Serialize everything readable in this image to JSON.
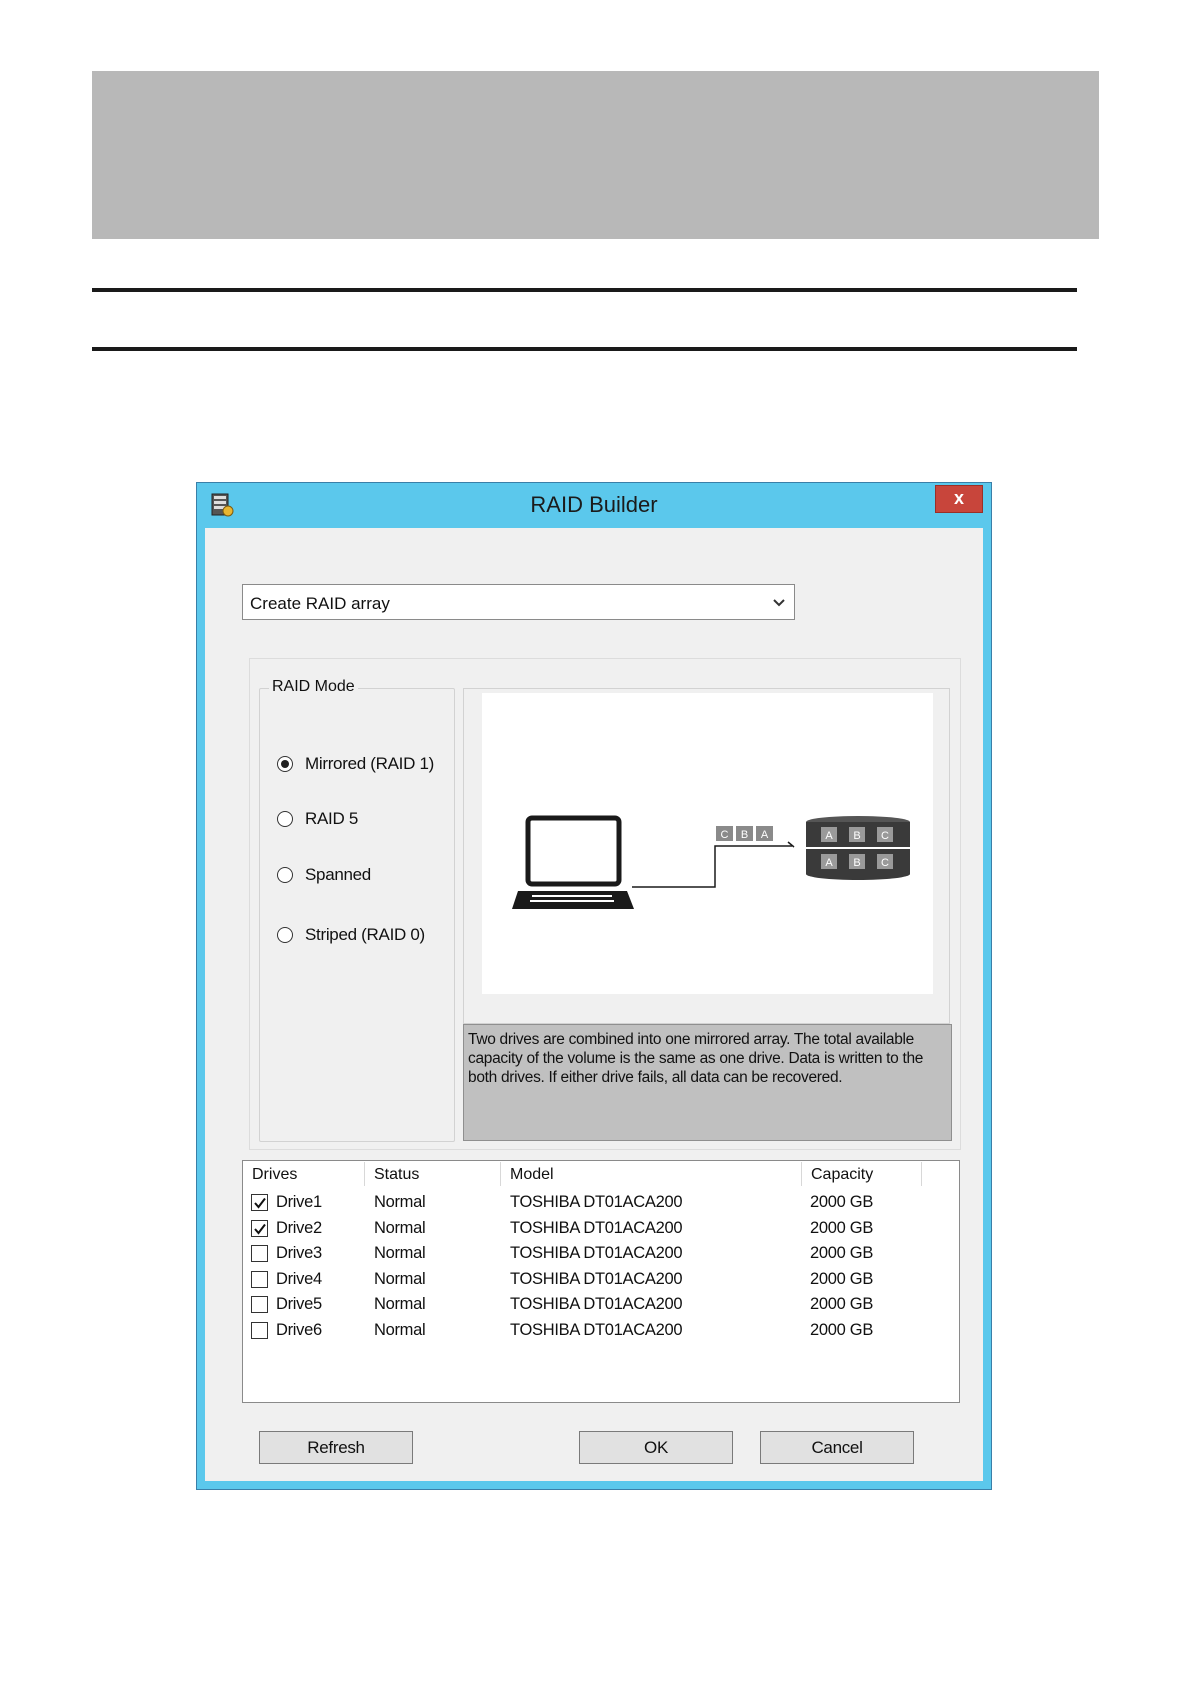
{
  "dialog": {
    "title": "RAID Builder",
    "app_icon": "raid-drive-icon",
    "close_label": "x"
  },
  "operation_select": {
    "value": "Create RAID array",
    "icon": "chevron-down-icon"
  },
  "raid_mode": {
    "legend": "RAID Mode",
    "options": [
      {
        "label": "Mirrored (RAID 1)",
        "checked": true
      },
      {
        "label": "RAID 5",
        "checked": false
      },
      {
        "label": "Spanned",
        "checked": false
      },
      {
        "label": "Striped (RAID 0)",
        "checked": false
      }
    ]
  },
  "diagram": {
    "computer_icon": "laptop-icon",
    "data_blocks": [
      "C",
      "B",
      "A"
    ],
    "disk_rows": [
      [
        "A",
        "B",
        "C"
      ],
      [
        "A",
        "B",
        "C"
      ]
    ]
  },
  "description": "Two drives are combined into one mirrored array. The total available capacity of the volume is the same as one drive. Data is written to the both drives. If either drive fails, all data can be recovered.",
  "drive_table": {
    "columns": {
      "drives": "Drives",
      "status": "Status",
      "model": "Model",
      "capacity": "Capacity"
    },
    "rows": [
      {
        "name": "Drive1",
        "checked": true,
        "status": "Normal",
        "model": "TOSHIBA DT01ACA200",
        "capacity": "2000 GB"
      },
      {
        "name": "Drive2",
        "checked": true,
        "status": "Normal",
        "model": "TOSHIBA DT01ACA200",
        "capacity": "2000 GB"
      },
      {
        "name": "Drive3",
        "checked": false,
        "status": "Normal",
        "model": "TOSHIBA DT01ACA200",
        "capacity": "2000 GB"
      },
      {
        "name": "Drive4",
        "checked": false,
        "status": "Normal",
        "model": "TOSHIBA DT01ACA200",
        "capacity": "2000 GB"
      },
      {
        "name": "Drive5",
        "checked": false,
        "status": "Normal",
        "model": "TOSHIBA DT01ACA200",
        "capacity": "2000 GB"
      },
      {
        "name": "Drive6",
        "checked": false,
        "status": "Normal",
        "model": "TOSHIBA DT01ACA200",
        "capacity": "2000 GB"
      }
    ]
  },
  "buttons": {
    "refresh": "Refresh",
    "ok": "OK",
    "cancel": "Cancel"
  },
  "colors": {
    "titlebar": "#5bc8ec",
    "close_button": "#c8453b",
    "page_header_band": "#b8b8b8",
    "description_bg": "#c0c0c0"
  }
}
